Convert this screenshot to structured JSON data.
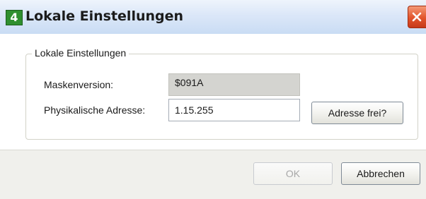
{
  "window": {
    "title": "Lokale Einstellungen",
    "icon_glyph": "4",
    "app_icon": "app-logo-icon",
    "close_icon": "close-icon",
    "accent_colors": {
      "titlebar": "#dbe7f8",
      "close": "#e2542b",
      "app_icon": "#2f8f2f"
    }
  },
  "group": {
    "legend": "Lokale Einstellungen",
    "mask_version_label": "Maskenversion:",
    "mask_version_value": "$091A",
    "physical_address_label": "Physikalische Adresse:",
    "physical_address_value": "1.15.255",
    "address_free_button": "Adresse frei?"
  },
  "footer": {
    "ok_button": "OK",
    "ok_enabled": false,
    "cancel_button": "Abbrechen"
  }
}
